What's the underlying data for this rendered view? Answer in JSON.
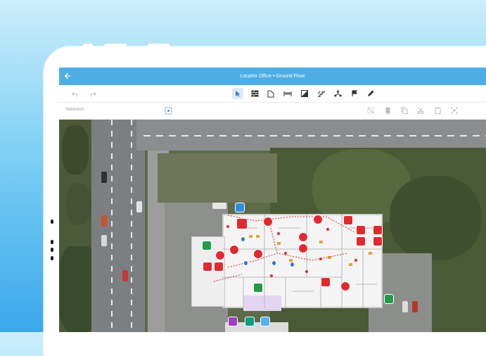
{
  "app": {
    "title": "Locatrix Office • Ground Floor",
    "back_icon": "arrow-left-icon"
  },
  "toolbar": {
    "tools": [
      {
        "name": "undo-icon",
        "glyph": "↶",
        "state": "dim"
      },
      {
        "name": "redo-icon",
        "glyph": "↷",
        "state": "dim"
      },
      {
        "name": "pointer-icon",
        "glyph": "➤",
        "state": "active"
      },
      {
        "name": "wall-icon",
        "glyph": "▦",
        "state": "normal"
      },
      {
        "name": "room-icon",
        "glyph": "◺",
        "state": "normal"
      },
      {
        "name": "furniture-icon",
        "glyph": "⊓",
        "state": "normal"
      },
      {
        "name": "area-icon",
        "glyph": "◩",
        "state": "normal"
      },
      {
        "name": "stairs-icon",
        "glyph": "⚏",
        "state": "normal"
      },
      {
        "name": "route-icon",
        "glyph": "⋏",
        "state": "normal"
      },
      {
        "name": "marker-icon",
        "glyph": "⚑",
        "state": "normal"
      },
      {
        "name": "pen-icon",
        "glyph": "✎",
        "state": "normal"
      }
    ]
  },
  "selection_bar": {
    "label": "Selection",
    "tools": [
      {
        "name": "select-area-icon",
        "glyph": "⬚",
        "state": "active"
      },
      {
        "name": "deselect-icon",
        "glyph": "⬚",
        "state": "dim"
      },
      {
        "name": "delete-icon",
        "glyph": "🗑",
        "state": "dim"
      },
      {
        "name": "copy-icon",
        "glyph": "❐",
        "state": "dim"
      },
      {
        "name": "cut-icon",
        "glyph": "✂",
        "state": "dim"
      },
      {
        "name": "paste-icon",
        "glyph": "📋",
        "state": "dim"
      },
      {
        "name": "fit-icon",
        "glyph": "⛶",
        "state": "dim"
      }
    ]
  },
  "colors": {
    "appbar": "#4eaee4",
    "active_tool": "#3b7fc4",
    "marker_red": "#e2292f",
    "marker_green": "#1f9b4b",
    "marker_blue": "#2f8de0"
  }
}
